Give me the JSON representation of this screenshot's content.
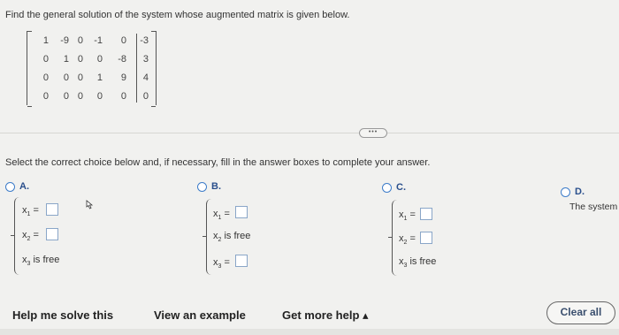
{
  "question": {
    "prompt": "Find the general solution of the system whose augmented matrix is given below.",
    "instructions": "Select the correct choice below and, if necessary, fill in the answer boxes to complete your answer."
  },
  "matrix": {
    "rows": [
      [
        "1",
        "-9",
        "0",
        "-1",
        "0",
        "-3"
      ],
      [
        "0",
        "1",
        "0",
        "0",
        "-8",
        "3"
      ],
      [
        "0",
        "0",
        "0",
        "1",
        "9",
        "4"
      ],
      [
        "0",
        "0",
        "0",
        "0",
        "0",
        "0"
      ]
    ]
  },
  "more_indicator": "•••",
  "choices": {
    "a": {
      "letter": "A.",
      "lines": [
        {
          "var": "x",
          "sub": "1",
          "text": " ="
        },
        {
          "var": "x",
          "sub": "2",
          "text": " ="
        },
        {
          "var": "x",
          "sub": "3",
          "text": " is free"
        }
      ]
    },
    "b": {
      "letter": "B.",
      "lines": [
        {
          "var": "x",
          "sub": "1",
          "text": " ="
        },
        {
          "var": "x",
          "sub": "2",
          "text": " is free"
        },
        {
          "var": "x",
          "sub": "3",
          "text": " ="
        }
      ]
    },
    "c": {
      "letter": "C.",
      "lines": [
        {
          "var": "x",
          "sub": "1",
          "text": " ="
        },
        {
          "var": "x",
          "sub": "2",
          "text": " ="
        },
        {
          "var": "x",
          "sub": "3",
          "text": " is free"
        }
      ]
    },
    "d": {
      "letter": "D.",
      "text": "The system"
    }
  },
  "footer": {
    "help_label": "Help me solve this",
    "example_label": "View an example",
    "more_help_label": "Get more help ▴",
    "clear_label": "Clear all"
  },
  "colors": {
    "accent": "#3d7cc9",
    "background": "#f1f1ef"
  }
}
